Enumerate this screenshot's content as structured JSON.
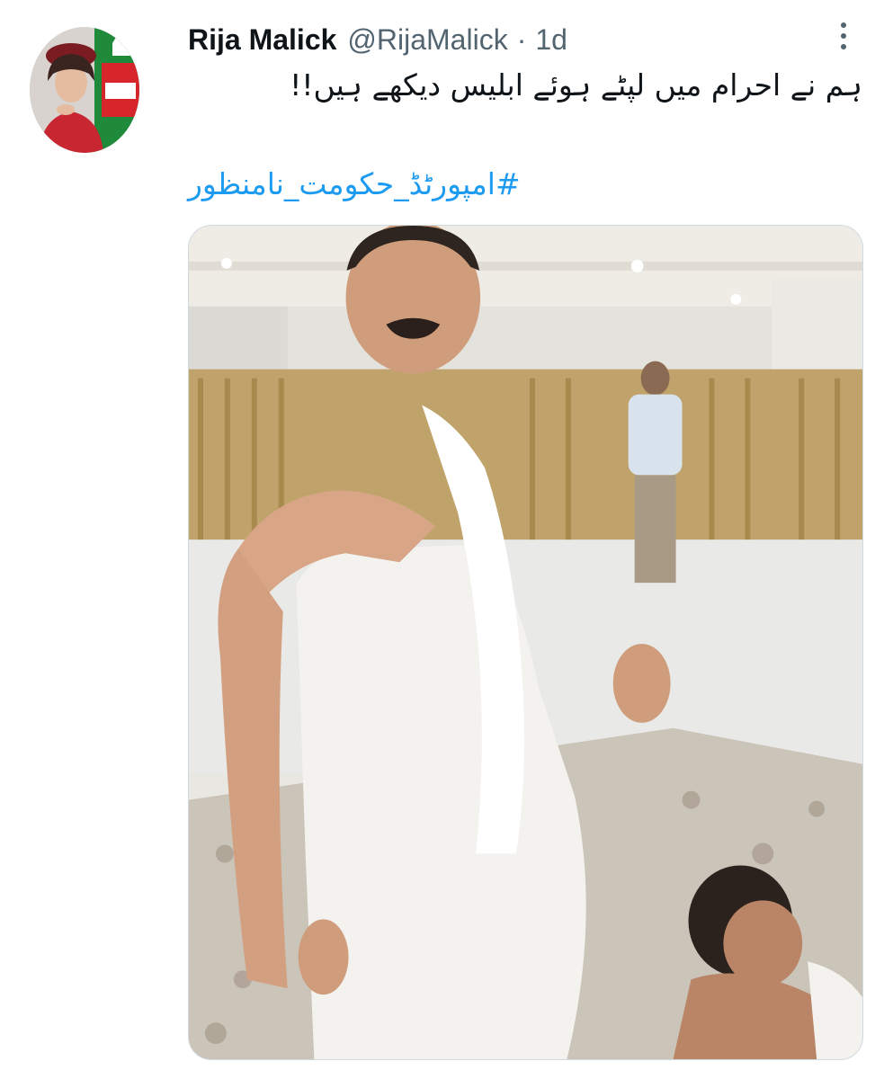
{
  "author": {
    "display_name": "Rija Malick",
    "handle": "@RijaMalick",
    "separator": "·",
    "time": "1d"
  },
  "tweet": {
    "text": "ہم نے احرام میں لپٹے ہوئے ابلیس دیکھے ہیں!!",
    "hashtag": "#امپورٹڈ_حکومت_نامنظور"
  },
  "icons": {
    "avatar": "profile-photo",
    "more": "more-options-icon"
  },
  "colors": {
    "text_primary": "#0f1419",
    "text_secondary": "#536471",
    "link": "#1d9bf0"
  }
}
